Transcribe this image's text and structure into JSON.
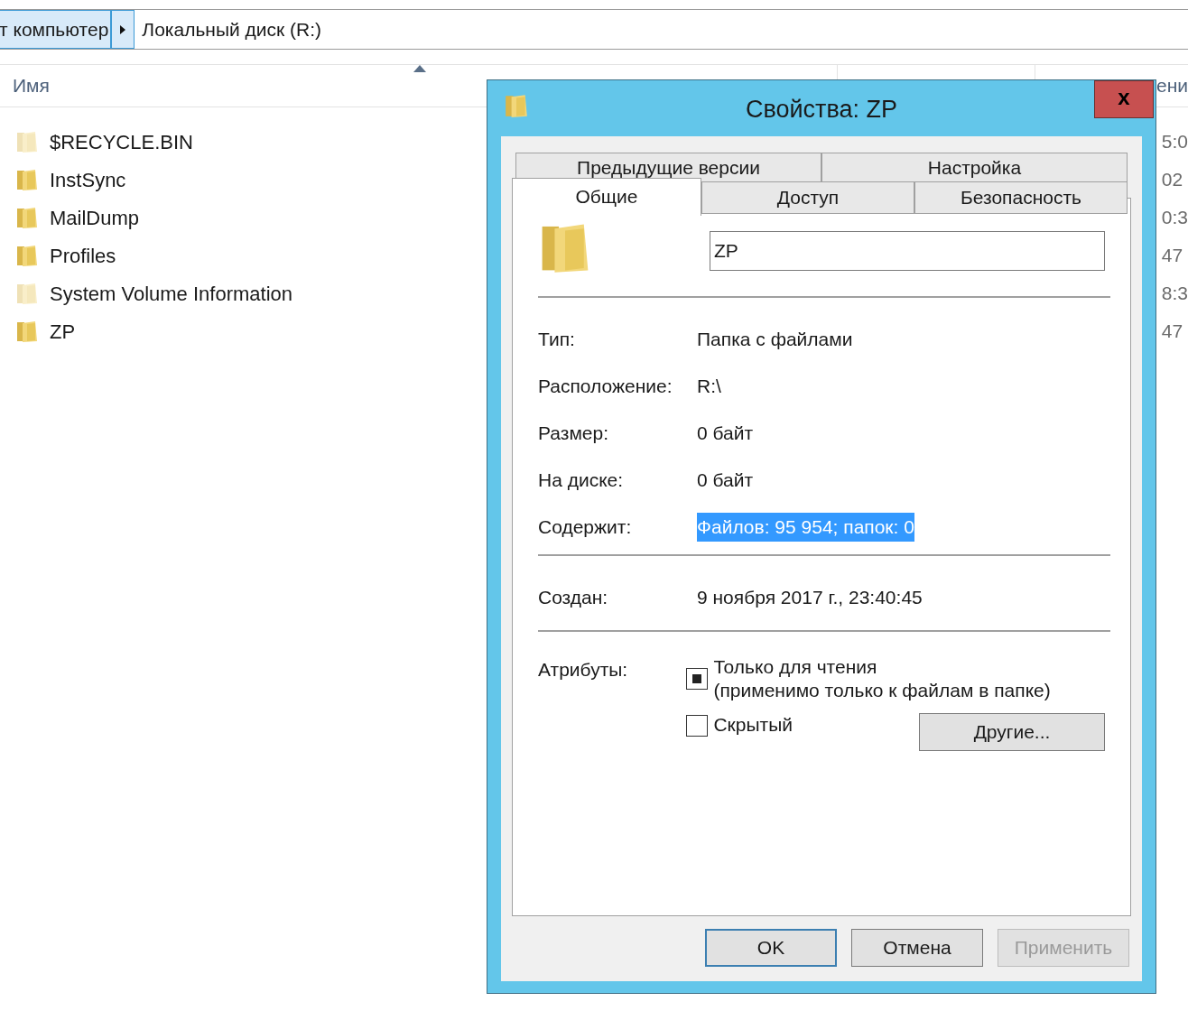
{
  "address_bar": {
    "segments": [
      {
        "label": "т компьютер",
        "selected": true
      },
      {
        "label": "Локальный диск (R:)",
        "selected": false
      }
    ]
  },
  "file_list": {
    "columns": [
      {
        "label": "Имя"
      },
      {
        "label": "ени"
      }
    ],
    "rows": [
      {
        "name": "$RECYCLE.BIN",
        "hidden": true,
        "column_2": "5:0"
      },
      {
        "name": "InstSync",
        "hidden": false,
        "column_2": "02"
      },
      {
        "name": "MailDump",
        "hidden": false,
        "column_2": "0:3"
      },
      {
        "name": "Profiles",
        "hidden": false,
        "column_2": "47"
      },
      {
        "name": "System Volume Information",
        "hidden": true,
        "column_2": "8:3"
      },
      {
        "name": "ZP",
        "hidden": false,
        "column_2": "47"
      }
    ]
  },
  "dialog": {
    "title": "Свойства: ZP",
    "close": "x",
    "tab_rows": [
      [
        {
          "label": "Предыдущие версии",
          "selected": false
        },
        {
          "label": "Настройка",
          "selected": false
        }
      ],
      [
        {
          "label": "Общие",
          "selected": true
        },
        {
          "label": "Доступ",
          "selected": false
        },
        {
          "label": "Безопасность",
          "selected": false
        }
      ]
    ],
    "name_field": {
      "value": "ZP"
    },
    "groups": [
      [
        {
          "label": "Тип:",
          "value": "Папка с файлами",
          "highlighted": false
        },
        {
          "label": "Расположение:",
          "value": "R:\\",
          "highlighted": false
        },
        {
          "label": "Размер:",
          "value": "0 байт",
          "highlighted": false
        },
        {
          "label": "На диске:",
          "value": "0 байт",
          "highlighted": false
        },
        {
          "label": "Содержит:",
          "value": "Файлов: 95 954; папок: 0",
          "highlighted": true
        }
      ],
      [
        {
          "label": "Создан:",
          "value": "9 ноября 2017 г., 23:40:45",
          "highlighted": false
        }
      ]
    ],
    "attributes": {
      "label": "Атрибуты:",
      "items": [
        {
          "label": "Только для чтения",
          "note": "(применимо только к файлам в папке)",
          "checked": true
        },
        {
          "label": "Скрытый",
          "checked": false
        }
      ],
      "other_button": "Другие..."
    },
    "buttons": [
      {
        "label": "OK",
        "kind": "default",
        "disabled": false
      },
      {
        "label": "Отмена",
        "kind": "normal",
        "disabled": false
      },
      {
        "label": "Применить",
        "kind": "normal",
        "disabled": true
      }
    ]
  }
}
